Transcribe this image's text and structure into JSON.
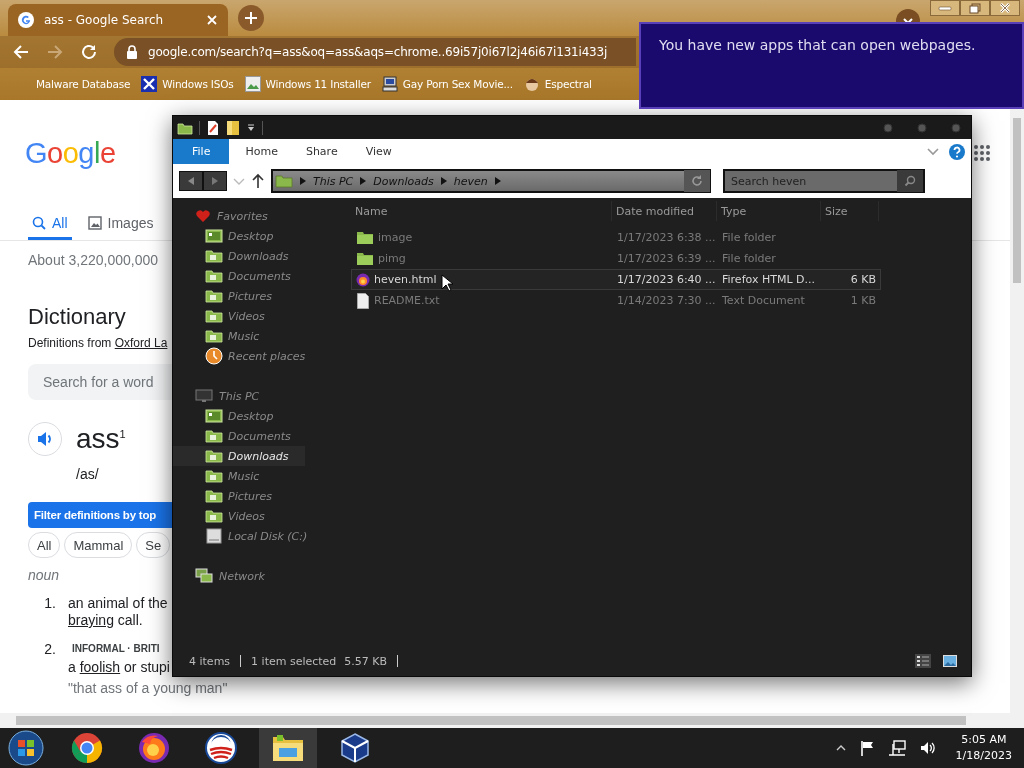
{
  "browser": {
    "tabs": [
      {
        "title": "ass - Google Search",
        "selected": true
      }
    ],
    "address": "google.com/search?q=ass&oq=ass&aqs=chrome..69i57j0i67l2j46i67i131i433j",
    "bookmarks": [
      {
        "label": "Malware Database",
        "kind": "none"
      },
      {
        "label": "Windows ISOs",
        "kind": "x"
      },
      {
        "label": "Windows 11 Installer",
        "kind": "image"
      },
      {
        "label": "Gay Porn Sex Movie...",
        "kind": "computer"
      },
      {
        "label": "Espectral",
        "kind": "avatar"
      }
    ]
  },
  "google": {
    "logo": "Google",
    "search_tabs": [
      {
        "label": "All",
        "kind": "search",
        "selected": true
      },
      {
        "label": "Images",
        "kind": "image",
        "selected": false
      }
    ],
    "result_stats": "About 3,220,000,000",
    "dictionary": {
      "heading": "Dictionary",
      "source_prefix": "Definitions from ",
      "source_link": "Oxford La",
      "search_placeholder": "Search for a word",
      "word": "ass",
      "superscript": "1",
      "pronunciation": "/as/",
      "filter_label": "Filter definitions by top",
      "chips": [
        {
          "label": "All",
          "selected": false
        },
        {
          "label": "Mammal",
          "selected": false
        },
        {
          "label": "Se",
          "selected": false
        }
      ],
      "part_of_speech": "noun",
      "definitions": [
        {
          "number": "1.",
          "lines": [
            [
              {
                "t": "an animal of the"
              }
            ],
            [
              {
                "t": "braying",
                "link": true
              },
              {
                "t": " call."
              }
            ]
          ]
        },
        {
          "number": "2.",
          "register": "INFORMAL · BRITI",
          "lines": [
            [
              {
                "t": "a "
              },
              {
                "t": "foolish",
                "link": true
              },
              {
                "t": " or stupi"
              }
            ]
          ],
          "example": "\"that ass of a young man\""
        }
      ]
    }
  },
  "explorer": {
    "ribbon_tabs": [
      {
        "label": "File",
        "selected": true
      },
      {
        "label": "Home",
        "selected": false
      },
      {
        "label": "Share",
        "selected": false
      },
      {
        "label": "View",
        "selected": false
      }
    ],
    "breadcrumb": [
      "This PC",
      "Downloads",
      "heven"
    ],
    "search_placeholder": "Search heven",
    "nav": [
      {
        "label": "Favorites",
        "kind": "heart",
        "children": [
          {
            "label": "Desktop",
            "kind": "desktop",
            "selected": false
          },
          {
            "label": "Downloads",
            "kind": "folder",
            "selected": false
          },
          {
            "label": "Documents",
            "kind": "folder",
            "selected": false
          },
          {
            "label": "Pictures",
            "kind": "folder",
            "selected": false
          },
          {
            "label": "Videos",
            "kind": "folder",
            "selected": false
          },
          {
            "label": "Music",
            "kind": "folder",
            "selected": false
          },
          {
            "label": "Recent places",
            "kind": "clock",
            "selected": false
          }
        ]
      },
      {
        "label": "This PC",
        "kind": "monitor",
        "children": [
          {
            "label": "Desktop",
            "kind": "desktop",
            "selected": false
          },
          {
            "label": "Documents",
            "kind": "folder",
            "selected": false
          },
          {
            "label": "Downloads",
            "kind": "folder",
            "selected": true
          },
          {
            "label": "Music",
            "kind": "folder",
            "selected": false
          },
          {
            "label": "Pictures",
            "kind": "folder",
            "selected": false
          },
          {
            "label": "Videos",
            "kind": "folder",
            "selected": false
          },
          {
            "label": "Local Disk (C:)",
            "kind": "drive",
            "selected": false
          }
        ]
      },
      {
        "label": "Network",
        "kind": "network"
      }
    ],
    "columns": [
      "Name",
      "Date modified",
      "Type",
      "Size"
    ],
    "files": [
      {
        "name": "image",
        "date": "1/17/2023 6:38 ...",
        "type": "File folder",
        "kind": "folder",
        "selected": false
      },
      {
        "name": "pimg",
        "date": "1/17/2023 6:39 ...",
        "type": "File folder",
        "kind": "folder",
        "selected": false
      },
      {
        "name": "heven.html",
        "date": "1/17/2023 6:40 ...",
        "type": "Firefox HTML D...",
        "size": "6 KB",
        "kind": "firefox",
        "selected": true
      },
      {
        "name": "README.txt",
        "date": "1/14/2023 7:30 ...",
        "type": "Text Document",
        "size": "1 KB",
        "kind": "text",
        "selected": false
      }
    ],
    "status": {
      "count": "4 items",
      "selection": "1 item selected",
      "size": "5.57 KB"
    }
  },
  "toast": {
    "message": "You have new apps that can open webpages."
  },
  "taskbar": {
    "apps": [
      {
        "kind": "chrome",
        "active": false
      },
      {
        "kind": "firefox",
        "active": false
      },
      {
        "kind": "circle-logo",
        "active": false
      },
      {
        "kind": "explorer",
        "active": true
      },
      {
        "kind": "cube",
        "active": false
      }
    ],
    "time": "5:05 AM",
    "date": "1/18/2023"
  }
}
